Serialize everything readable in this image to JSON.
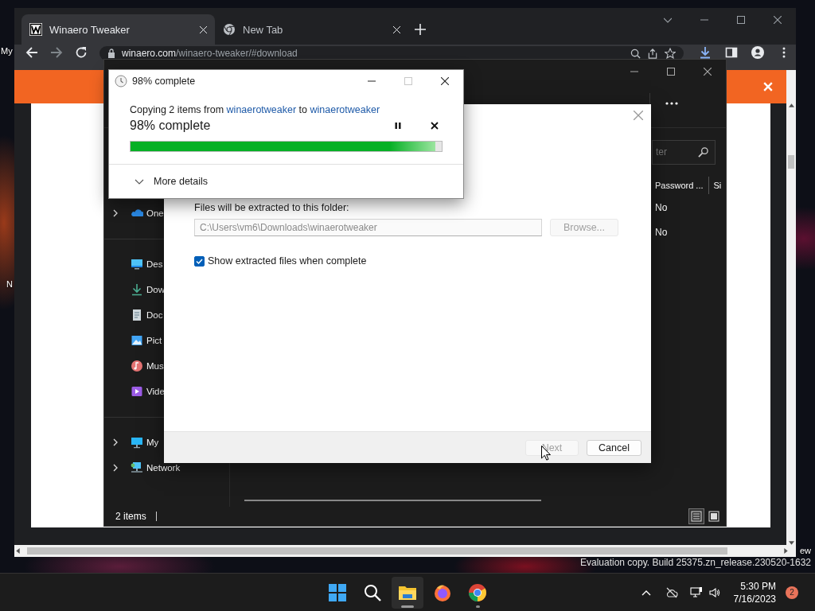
{
  "desktop": {
    "labels": [
      "My",
      "N",
      "ew"
    ],
    "watermark": "Evaluation copy. Build 25375.zn_release.230520-1632"
  },
  "browser": {
    "tabs": [
      {
        "title": "Winaero Tweaker",
        "kind": "site",
        "selected": true
      },
      {
        "title": "New Tab",
        "kind": "chrome",
        "selected": false
      }
    ],
    "address_host": "winaero.com",
    "address_path": "/winaero-tweaker/#download"
  },
  "explorer": {
    "search_placeholder": "ter",
    "nav_groups": [
      [
        {
          "label": "One",
          "kind": "onedrive",
          "expandable": true
        }
      ],
      [
        {
          "label": "Des",
          "kind": "desktop",
          "expandable": false
        },
        {
          "label": "Dow",
          "kind": "downloads",
          "expandable": false
        },
        {
          "label": "Doc",
          "kind": "documents",
          "expandable": false
        },
        {
          "label": "Pict",
          "kind": "pictures",
          "expandable": false
        },
        {
          "label": "Mus",
          "kind": "music",
          "expandable": false
        },
        {
          "label": "Vide",
          "kind": "videos",
          "expandable": false
        }
      ],
      [
        {
          "label": "My",
          "kind": "pc",
          "expandable": true
        },
        {
          "label": "Network",
          "kind": "network",
          "expandable": true
        }
      ]
    ],
    "columns": [
      "Password ...",
      "Si"
    ],
    "rows": [
      [
        "No"
      ],
      [
        "No"
      ]
    ],
    "status": "2 items",
    "views": [
      {
        "kind": "details",
        "selected": true
      },
      {
        "kind": "tiles",
        "selected": false
      }
    ]
  },
  "extract_dialog": {
    "folder_label": "Files will be extracted to this folder:",
    "folder_path": "C:\\Users\\vm6\\Downloads\\winaerotweaker",
    "path_disabled": true,
    "browse": {
      "label": "Browse...",
      "disabled": true
    },
    "show_files": {
      "label": "Show extracted files when complete",
      "checked": true
    },
    "buttons": [
      {
        "label": "Next",
        "disabled": true
      },
      {
        "label": "Cancel",
        "disabled": false
      }
    ]
  },
  "copy_dialog": {
    "title": "98% complete",
    "message": [
      {
        "text": "Copying 2 items from ",
        "kind": "text"
      },
      {
        "text": "winaerotweaker",
        "kind": "link"
      },
      {
        "text": " to ",
        "kind": "text"
      },
      {
        "text": "winaerotweaker",
        "kind": "link"
      }
    ],
    "status": "98% complete",
    "level": 0.98,
    "details": {
      "label": "More details",
      "expanded": false
    }
  },
  "taskbar": {
    "apps": [
      {
        "kind": "start",
        "selected": false,
        "running": false
      },
      {
        "kind": "search",
        "selected": false,
        "running": false
      },
      {
        "kind": "explorer",
        "selected": true,
        "running": true
      },
      {
        "kind": "firefox",
        "selected": false,
        "running": false
      },
      {
        "kind": "chrome",
        "selected": false,
        "running": true
      }
    ],
    "time": "5:30 PM",
    "date": "7/16/2023",
    "notifications": "2"
  }
}
